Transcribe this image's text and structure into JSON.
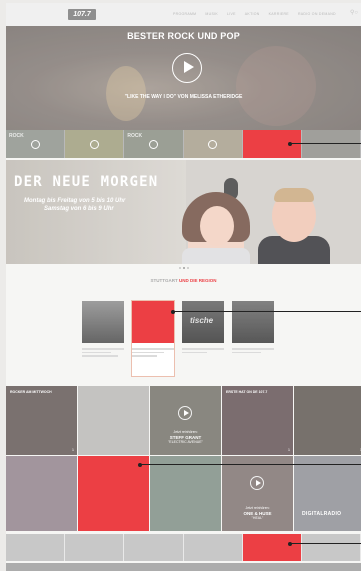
{
  "nav": {
    "logo_text": "107.7",
    "links": [
      "PROGRAMM",
      "MUSIK",
      "LIVE",
      "AKTION",
      "KARRIERE",
      "RADIO ON DEMAND"
    ]
  },
  "hero": {
    "title": "BESTER ROCK UND POP",
    "subtitle": "\"LIKE THE WAY I DO\" VON MELISSA ETHERIDGE"
  },
  "strip": {
    "tags": [
      "ROCK",
      "",
      "ROCK",
      "",
      "",
      ""
    ]
  },
  "morning": {
    "title": "DER NEUE MORGEN",
    "line1": "Montag bis Freitag von 5 bis 10 Uhr",
    "line2": "Samstag von 6 bis 9 Uhr"
  },
  "section": {
    "prefix": "STUTTGART",
    "suffix": "UND DIE REGION"
  },
  "cards": [
    {
      "image_label": ""
    },
    {
      "image_label": ""
    },
    {
      "image_label": "tische"
    },
    {
      "image_label": ""
    }
  ],
  "tiles": [
    {
      "title": "ROCKER AM MITTWOCH",
      "number": "1"
    },
    {
      "title": "",
      "number": ""
    },
    {
      "title": "",
      "caption_small": "Jetzt reinhören:",
      "caption_big": "STEFF GRANT",
      "caption_line": "\"ELECTRIC AVENUE\"",
      "number": ""
    },
    {
      "title": "ERSTE HAT ON DE 107.7",
      "number": "1"
    },
    {
      "title": "",
      "number": "1"
    },
    {
      "title": "",
      "number": ""
    },
    {
      "title": "",
      "number": ""
    },
    {
      "title": "",
      "number": ""
    },
    {
      "title": "",
      "caption_small": "Jetzt reinhören:",
      "caption_big": "ONE & HUSE",
      "caption_line": "\"HEAL\"",
      "number": ""
    },
    {
      "title": "",
      "brand": "DIGITALRADIO",
      "number": ""
    }
  ]
}
